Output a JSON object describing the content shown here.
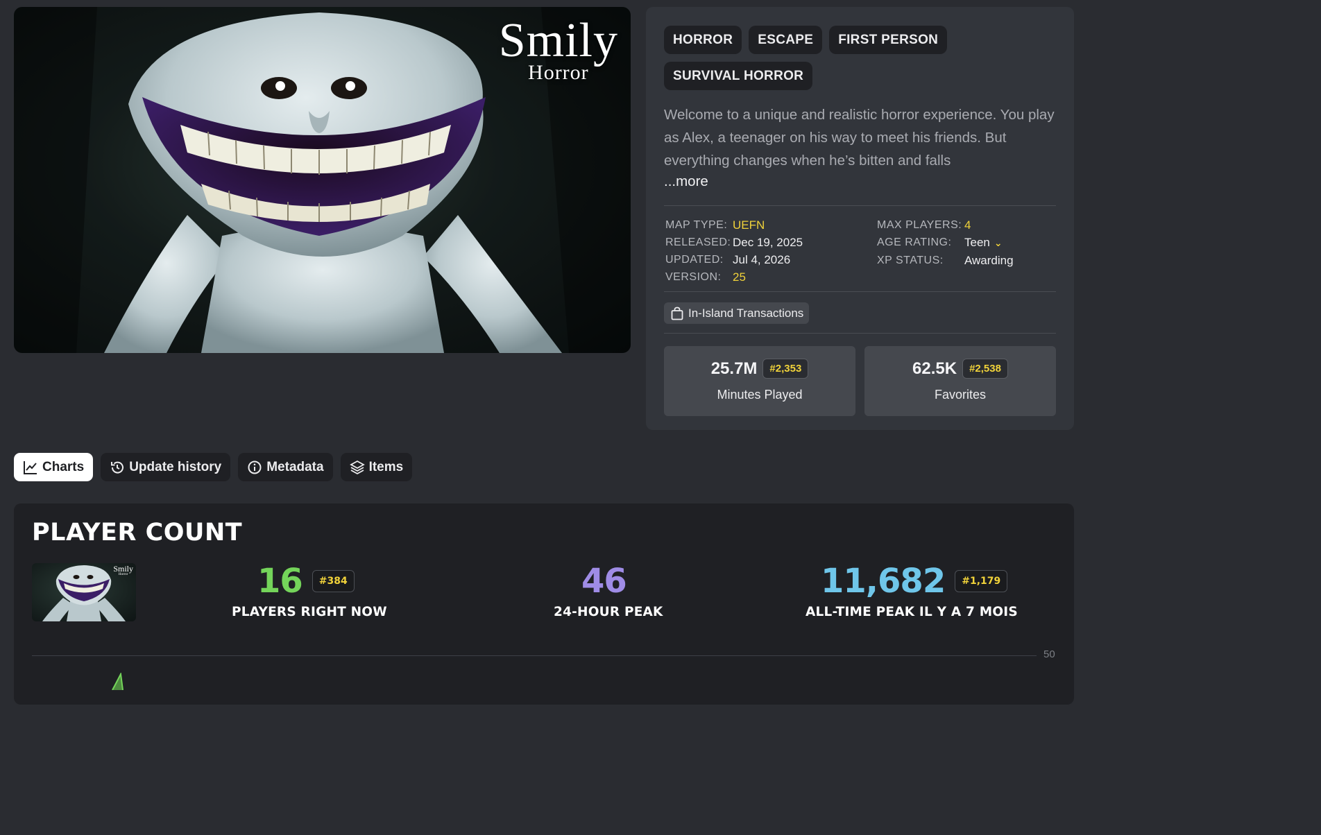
{
  "hero": {
    "title_line1": "Smily",
    "title_line2": "Horror"
  },
  "tags": [
    "HORROR",
    "ESCAPE",
    "FIRST PERSON",
    "SURVIVAL HORROR"
  ],
  "description": "Welcome to a unique and realistic horror experience. You play as Alex, a teenager on his way to meet his friends. But everything changes when he’s bitten and falls",
  "more_label": "...more",
  "meta_left": [
    {
      "key": "MAP TYPE:",
      "value": "UEFN",
      "highlight": true
    },
    {
      "key": "RELEASED:",
      "value": "Dec 19, 2025",
      "highlight": false
    },
    {
      "key": "UPDATED:",
      "value": "Jul 4, 2026",
      "highlight": false
    },
    {
      "key": "VERSION:",
      "value": "25",
      "highlight": true
    }
  ],
  "meta_right": [
    {
      "key": "MAX PLAYERS:",
      "value": "4",
      "highlight": true
    },
    {
      "key": "AGE RATING:",
      "value": "Teen",
      "highlight": false
    },
    {
      "key": "XP STATUS:",
      "value": "Awarding",
      "highlight": false
    }
  ],
  "transactions_label": "In-Island Transactions",
  "stats": [
    {
      "value": "25.7M",
      "rank": "#2,353",
      "label": "Minutes Played"
    },
    {
      "value": "62.5K",
      "rank": "#2,538",
      "label": "Favorites"
    }
  ],
  "tabs": [
    {
      "label": "Charts",
      "active": true
    },
    {
      "label": "Update history",
      "active": false
    },
    {
      "label": "Metadata",
      "active": false
    },
    {
      "label": "Items",
      "active": false
    }
  ],
  "player_count": {
    "title": "PLAYER COUNT",
    "thumb_line1": "Smily",
    "thumb_line2": "Horror",
    "now": {
      "value": "16",
      "rank": "#384",
      "label": "PLAYERS RIGHT NOW",
      "color": "#74d45a"
    },
    "peak24": {
      "value": "46",
      "label": "24-HOUR PEAK",
      "color": "#9f8ce6"
    },
    "alltime": {
      "value": "11,682",
      "rank": "#1,179",
      "label": "ALL-TIME PEAK IL Y A 7 MOIS",
      "color": "#6fc6ea"
    },
    "axis_max": "50"
  },
  "colors": {
    "accent_yellow": "#f0d23a",
    "panel": "#32353b",
    "card": "#45484e"
  }
}
